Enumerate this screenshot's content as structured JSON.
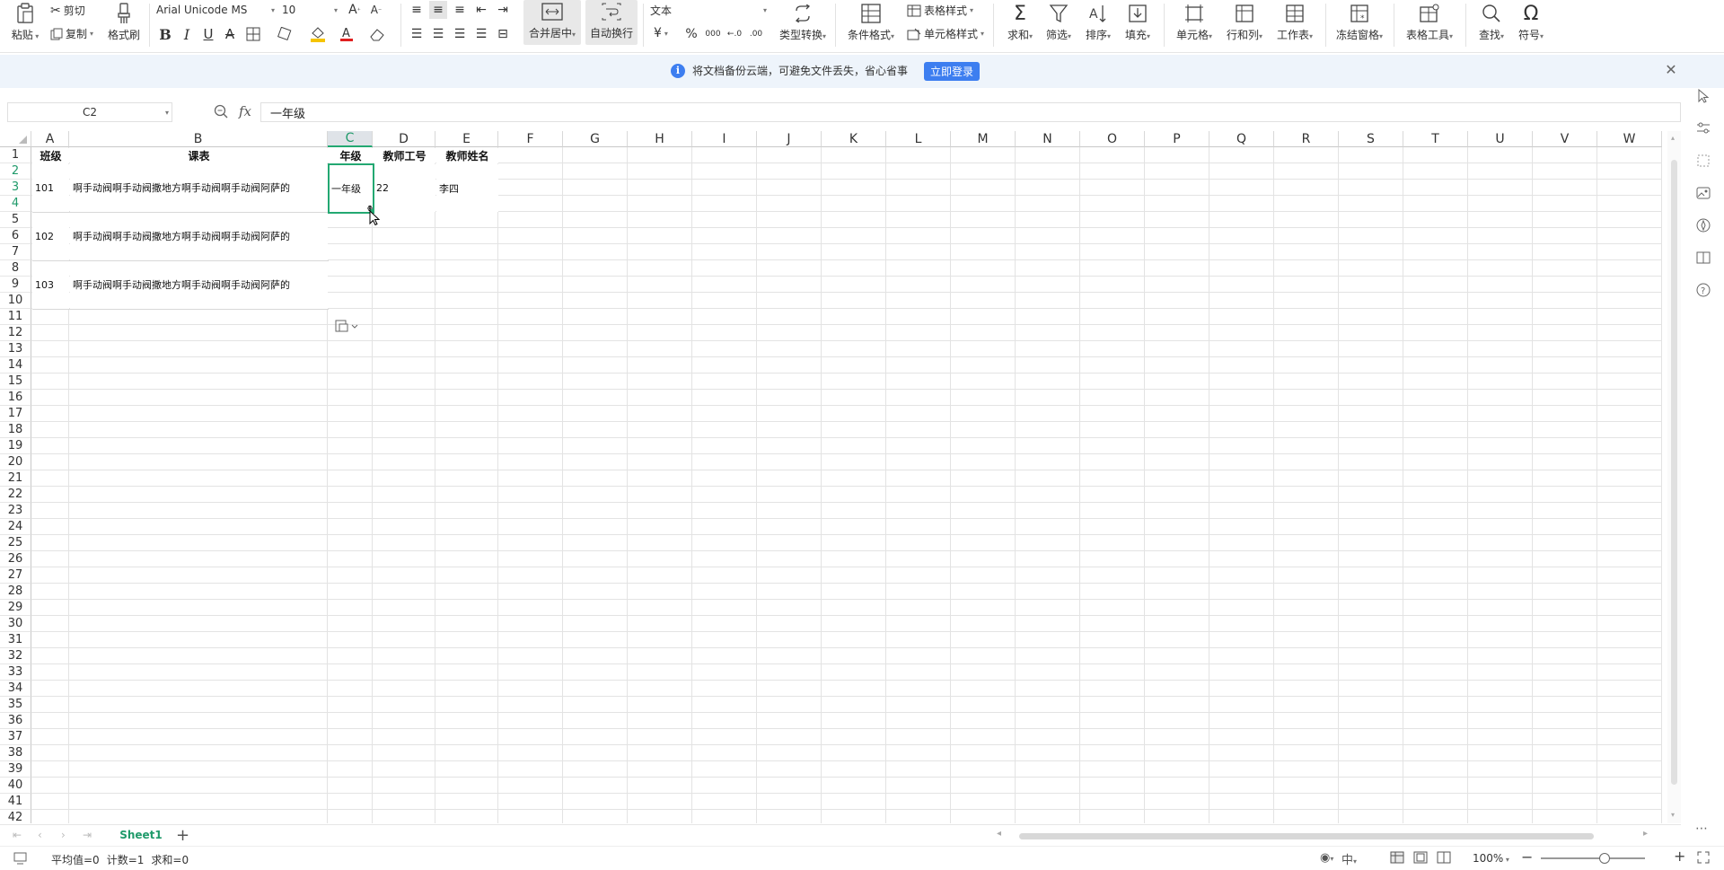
{
  "ribbon": {
    "paste": "粘贴",
    "cut": "剪切",
    "copy": "复制",
    "format_painter": "格式刷",
    "font_name": "Arial Unicode MS",
    "font_size": "10",
    "merge_center": "合并居中",
    "wrap_text": "自动换行",
    "number_format": "文本",
    "type_convert": "类型转换",
    "conditional_format": "条件格式",
    "table_style": "表格样式",
    "cell_style": "单元格样式",
    "sum": "求和",
    "filter": "筛选",
    "sort": "排序",
    "fill": "填充",
    "cell": "单元格",
    "row_col": "行和列",
    "worksheet": "工作表",
    "freeze": "冻结窗格",
    "table_tools": "表格工具",
    "find": "查找",
    "symbol": "符号"
  },
  "notice": {
    "message": "将文档备份云端，可避免文件丢失，省心省事",
    "login": "立即登录"
  },
  "formula_bar": {
    "name_box": "C2",
    "fx": "fx",
    "content": "一年级"
  },
  "columns": [
    "A",
    "B",
    "C",
    "D",
    "E",
    "F",
    "G",
    "H",
    "I",
    "J",
    "K",
    "L",
    "M",
    "N",
    "O",
    "P",
    "Q",
    "R",
    "S",
    "T",
    "U",
    "V",
    "W"
  ],
  "selected_column": "C",
  "rows": [
    "1",
    "2",
    "3",
    "4",
    "5",
    "6",
    "7",
    "8",
    "9",
    "10",
    "11",
    "12",
    "13",
    "14",
    "15",
    "16",
    "17",
    "18",
    "19",
    "20",
    "21",
    "22",
    "23",
    "24",
    "25",
    "26",
    "27",
    "28",
    "29",
    "30",
    "31",
    "32",
    "33",
    "34",
    "35",
    "36",
    "37",
    "38",
    "39",
    "40",
    "41",
    "42"
  ],
  "selected_rows": [
    "2",
    "3",
    "4"
  ],
  "sheet": {
    "headers": {
      "A": "班级",
      "B": "课表",
      "C": "年级",
      "D": "教师工号",
      "E": "教师姓名"
    },
    "records": [
      {
        "class": "101",
        "schedule": "啊手动阀啊手动阀撒地方啊手动阀啊手动阀阿萨的",
        "grade": "一年级",
        "teacher_id": "22",
        "teacher_name": "李四"
      },
      {
        "class": "102",
        "schedule": "啊手动阀啊手动阀撒地方啊手动阀啊手动阀阿萨的"
      },
      {
        "class": "103",
        "schedule": "啊手动阀啊手动阀撒地方啊手动阀啊手动阀阿萨的"
      }
    ]
  },
  "tabs": {
    "active_sheet": "Sheet1",
    "add": "+"
  },
  "status": {
    "average": "平均值=0",
    "count": "计数=1",
    "sum": "求和=0",
    "zoom": "100%"
  },
  "colors": {
    "accent_green": "#23a872",
    "login_blue": "#3d7ef0",
    "notice_bg": "#eef4fb"
  }
}
